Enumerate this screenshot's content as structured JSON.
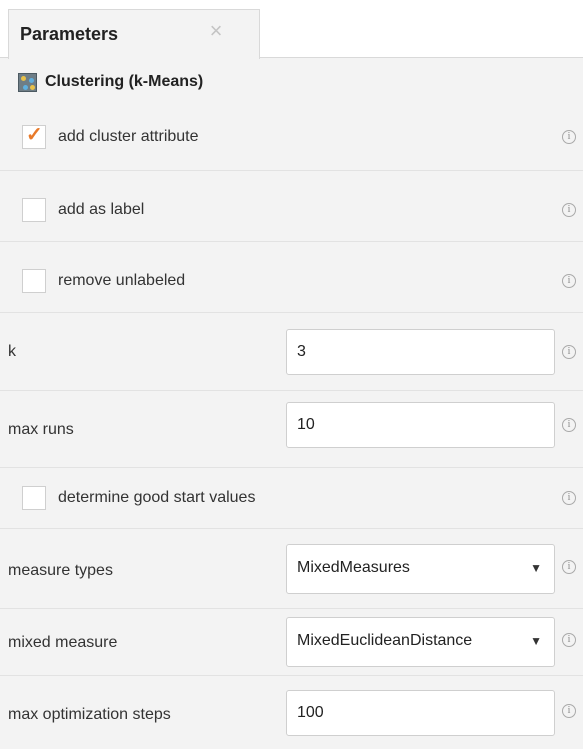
{
  "panel": {
    "tab_label": "Parameters",
    "tab_close_icon": "×",
    "info_glyph": "i"
  },
  "operator": {
    "name": "Clustering (k-Means)",
    "icon": "clustering-icon"
  },
  "params": {
    "add_cluster_attribute": {
      "label": "add cluster attribute",
      "checked": true,
      "check_glyph": "✓"
    },
    "add_as_label": {
      "label": "add as label",
      "checked": false
    },
    "remove_unlabeled": {
      "label": "remove unlabeled",
      "checked": false
    },
    "k": {
      "label": "k",
      "value": "3"
    },
    "max_runs": {
      "label": "max runs",
      "value": "10"
    },
    "determine_good_start_values": {
      "label": "determine good start values",
      "checked": false
    },
    "measure_types": {
      "label": "measure types",
      "value": "MixedMeasures",
      "arrow": "▼"
    },
    "mixed_measure": {
      "label": "mixed measure",
      "value": "MixedEuclideanDistance",
      "arrow": "▼"
    },
    "max_optimization_steps": {
      "label": "max optimization steps",
      "value": "100"
    }
  },
  "colors": {
    "accent": "#e87a2a",
    "panel_bg": "#f3f3f3",
    "border": "#cfcfcf"
  }
}
